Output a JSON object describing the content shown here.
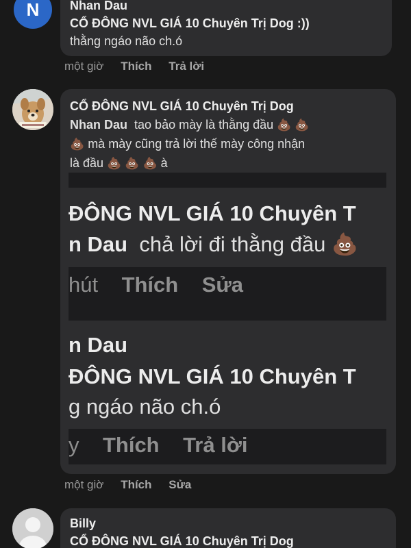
{
  "comment1": {
    "avatar_letter": "N",
    "author": "Nhan Dau",
    "line1": "CỔ ĐÔNG NVL GIÁ 10 Chuyên Trị Dog  :))",
    "line2": "thằng ngáo não ch.ó",
    "actions": {
      "time": "một giờ",
      "like": "Thích",
      "reply": "Trả lời"
    }
  },
  "comment2": {
    "author": "CỔ ĐÔNG NVL GIÁ 10 Chuyên Trị Dog",
    "mention": "Nhan Dau",
    "line1": "tao bảo mày là thằng đầu",
    "line2": "mà mày cũng trả lời thế mày công nhận",
    "line3": "là đầu",
    "line3_end": "à",
    "poop": "💩",
    "embed": {
      "row1_author": "ĐÔNG NVL GIÁ 10 Chuyên T",
      "row1_mention": "n Dau",
      "row1_text": "chả lời đi thằng đầu",
      "row1_time": "hút",
      "row1_like": "Thích",
      "row1_edit": "Sửa",
      "row2_author": "n Dau",
      "row2_line": "ĐÔNG NVL GIÁ 10 Chuyên T",
      "row2_text": "g ngáo não ch.ó",
      "row2_time": "y",
      "row2_like": "Thích",
      "row2_reply": "Trả lời"
    },
    "actions": {
      "time": "một giờ",
      "like": "Thích",
      "edit": "Sửa"
    }
  },
  "comment3": {
    "author": "Billy",
    "line1": "CỔ ĐÔNG NVL GIÁ 10 Chuyên Trị Dog"
  },
  "colors": {
    "background": "#191919",
    "bubble": "#2d2d2f",
    "avatar_blue": "#2b67c7"
  }
}
